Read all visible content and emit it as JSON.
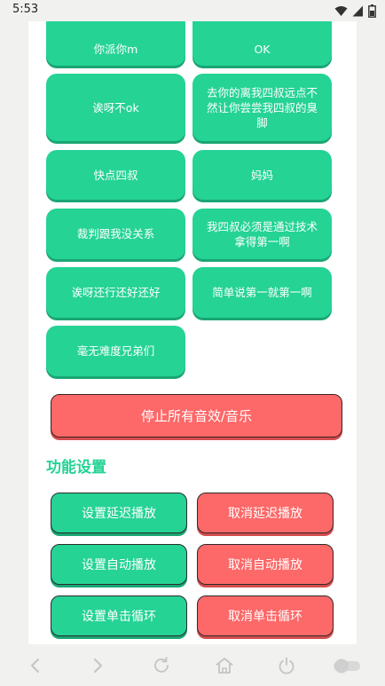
{
  "status_bar": {
    "time": "5:53"
  },
  "sound_buttons": [
    {
      "label": "你派你m"
    },
    {
      "label": "OK"
    },
    {
      "label": "诶呀不ok"
    },
    {
      "label": "去你的离我四叔远点不然让你尝尝我四叔的臭脚"
    },
    {
      "label": "快点四叔"
    },
    {
      "label": "妈妈"
    },
    {
      "label": "裁判跟我没关系"
    },
    {
      "label": "我四叔必须是通过技术拿得第一啊"
    },
    {
      "label": "诶呀还行还好还好"
    },
    {
      "label": "简单说第一就第一啊"
    },
    {
      "label": "毫无难度兄弟们"
    }
  ],
  "stop_all": {
    "label": "停止所有音效/音乐"
  },
  "settings": {
    "title": "功能设置",
    "buttons": [
      {
        "label": "设置延迟播放"
      },
      {
        "label": "取消延迟播放"
      },
      {
        "label": "设置自动播放"
      },
      {
        "label": "取消自动播放"
      },
      {
        "label": "设置单击循环"
      },
      {
        "label": "取消单击循环"
      }
    ]
  },
  "colors": {
    "accent_green": "#25d395",
    "accent_red": "#fd6868",
    "background": "#f1f1ef"
  },
  "icons": {
    "status": [
      "wifi-icon",
      "signal-icon",
      "battery-icon"
    ],
    "nav": [
      "back-icon",
      "forward-icon",
      "refresh-icon",
      "home-icon",
      "power-icon",
      "toggle-icon"
    ]
  }
}
